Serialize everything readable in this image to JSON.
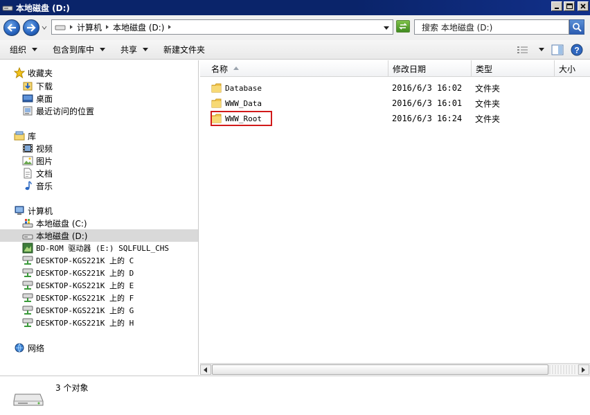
{
  "window": {
    "title": "本地磁盘 (D:)"
  },
  "address": {
    "crumbs": [
      "计算机",
      "本地磁盘 (D:)"
    ],
    "search_placeholder": "搜索 本地磁盘 (D:)"
  },
  "toolbar": {
    "organize": "组织",
    "include_in_library": "包含到库中",
    "share": "共享",
    "new_folder": "新建文件夹"
  },
  "nav": {
    "favorites": {
      "label": "收藏夹",
      "items": [
        "下载",
        "桌面",
        "最近访问的位置"
      ]
    },
    "libraries": {
      "label": "库",
      "items": [
        "视频",
        "图片",
        "文档",
        "音乐"
      ]
    },
    "computer": {
      "label": "计算机",
      "items": [
        "本地磁盘 (C:)",
        "本地磁盘 (D:)",
        "BD-ROM 驱动器 (E:) SQLFULL_CHS",
        "DESKTOP-KGS221K 上的 C",
        "DESKTOP-KGS221K 上的 D",
        "DESKTOP-KGS221K 上的 E",
        "DESKTOP-KGS221K 上的 F",
        "DESKTOP-KGS221K 上的 G",
        "DESKTOP-KGS221K 上的 H"
      ]
    },
    "network": {
      "label": "网络"
    }
  },
  "columns": {
    "name": "名称",
    "modified": "修改日期",
    "type": "类型",
    "size": "大小"
  },
  "files": [
    {
      "name": "Database",
      "modified": "2016/6/3 16:02",
      "type": "文件夹"
    },
    {
      "name": "WWW_Data",
      "modified": "2016/6/3 16:01",
      "type": "文件夹"
    },
    {
      "name": "WWW_Root",
      "modified": "2016/6/3 16:24",
      "type": "文件夹"
    }
  ],
  "details": {
    "count": "3 个对象"
  },
  "colors": {
    "titlebar": "#0a246a",
    "highlight": "#d11a1a",
    "selection": "#d9d9d9"
  }
}
